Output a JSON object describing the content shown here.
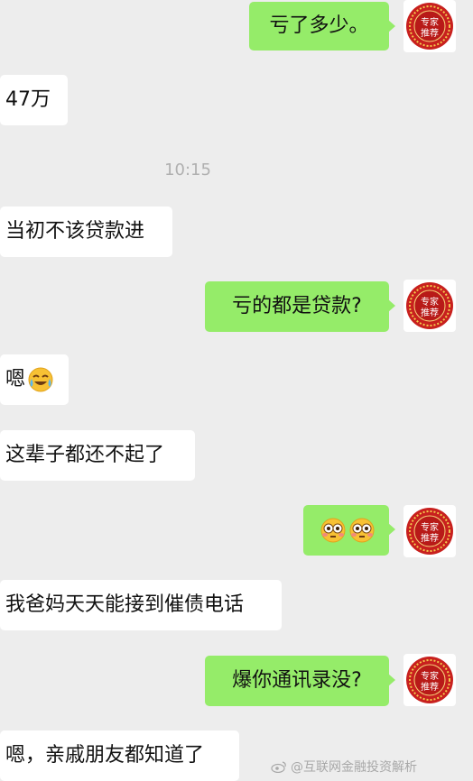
{
  "messages": {
    "m1": "亏了多少。",
    "m2": "47万",
    "timestamp": "10:15",
    "m3": "当初不该贷款进",
    "m4": "亏的都是贷款?",
    "m5": "嗯",
    "m6": "这辈子都还不起了",
    "m7_emoji": [
      "flushed-face-emoji",
      "flushed-face-emoji"
    ],
    "m8": "我爸妈天天能接到催债电话",
    "m9": "爆你通讯录没?",
    "m10": "嗯，亲戚朋友都知道了"
  },
  "avatar": {
    "top_text": "专家",
    "bottom_text": "推荐"
  },
  "watermark": {
    "text": "@互联网金融投资解析"
  },
  "colors": {
    "background": "#ededed",
    "incoming_bubble": "#ffffff",
    "outgoing_bubble": "#95ec69",
    "seal_red": "#c8201e",
    "seal_gold": "#f2c94c"
  }
}
